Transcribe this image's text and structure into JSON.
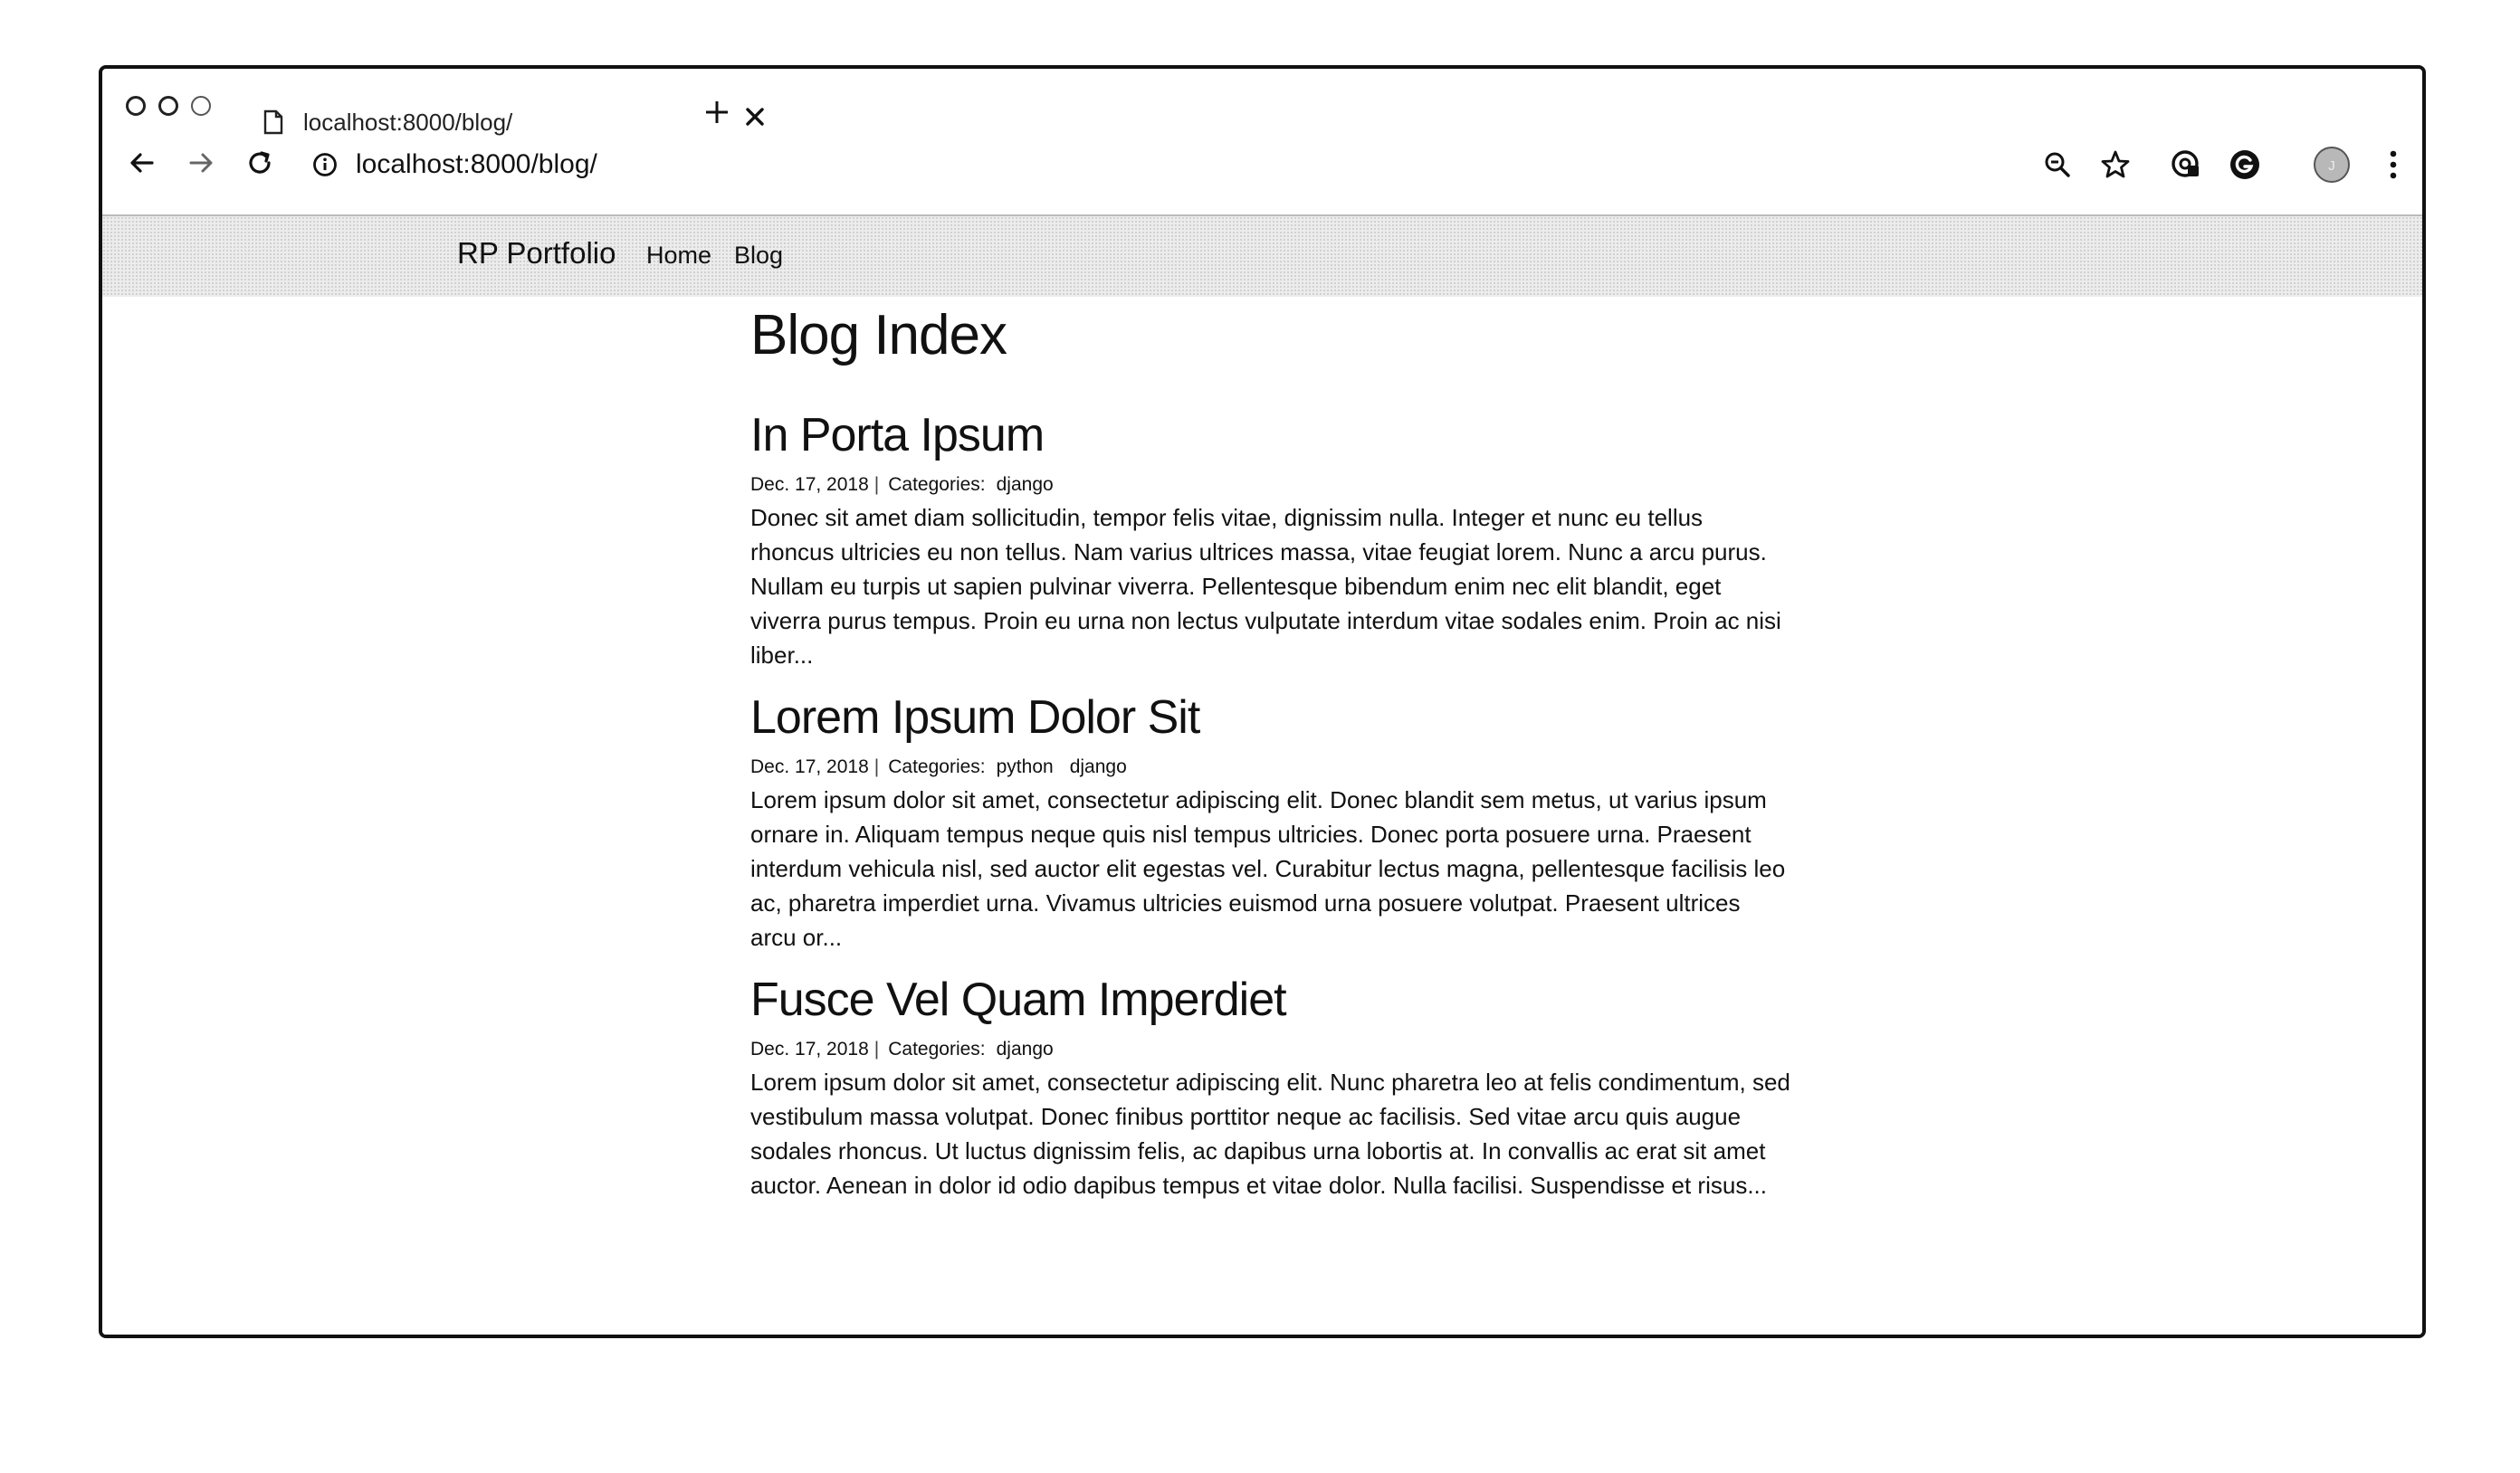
{
  "browser": {
    "tab_title": "localhost:8000/blog/",
    "url": "localhost:8000/blog/",
    "avatar_letter": "J",
    "icons": [
      "back-icon",
      "forward-icon",
      "reload-icon",
      "info-icon",
      "zoom-out-icon",
      "star-icon",
      "extension-icon",
      "grammarly-icon",
      "avatar",
      "menu-icon"
    ]
  },
  "site": {
    "brand": "RP Portfolio",
    "nav": [
      "Home",
      "Blog"
    ]
  },
  "page": {
    "title": "Blog Index",
    "posts": [
      {
        "title": "In Porta Ipsum",
        "date": "Dec. 17, 2018",
        "sep": "|",
        "categories_label": "Categories:",
        "categories": [
          "django"
        ],
        "excerpt": "Donec sit amet diam sollicitudin, tempor felis vitae, dignissim nulla. Integer et nunc eu tellus rhoncus ultricies eu non tellus. Nam varius ultrices massa, vitae feugiat lorem. Nunc a arcu purus. Nullam eu turpis ut sapien pulvinar viverra. Pellentesque bibendum enim nec elit blandit, eget viverra purus tempus. Proin eu urna non lectus vulputate interdum vitae sodales enim. Proin ac nisi liber..."
      },
      {
        "title": "Lorem Ipsum Dolor Sit",
        "date": "Dec. 17, 2018",
        "sep": "|",
        "categories_label": "Categories:",
        "categories": [
          "python",
          "django"
        ],
        "excerpt": "Lorem ipsum dolor sit amet, consectetur adipiscing elit. Donec blandit sem metus, ut varius ipsum ornare in. Aliquam tempus neque quis nisl tempus ultricies. Donec porta posuere urna. Praesent interdum vehicula nisl, sed auctor elit egestas vel. Curabitur lectus magna, pellentesque facilisis leo ac, pharetra imperdiet urna. Vivamus ultricies euismod urna posuere volutpat. Praesent ultrices arcu or..."
      },
      {
        "title": "Fusce Vel Quam Imperdiet",
        "date": "Dec. 17, 2018",
        "sep": "|",
        "categories_label": "Categories:",
        "categories": [
          "django"
        ],
        "excerpt": "Lorem ipsum dolor sit amet, consectetur adipiscing elit. Nunc pharetra leo at felis condimentum, sed vestibulum massa volutpat. Donec finibus porttitor neque ac facilisis. Sed vitae arcu quis augue sodales rhoncus. Ut luctus dignissim felis, ac dapibus urna lobortis at. In convallis ac erat sit amet auctor. Aenean in dolor id odio dapibus tempus et vitae dolor. Nulla facilisi. Suspendisse et risus..."
      }
    ]
  }
}
